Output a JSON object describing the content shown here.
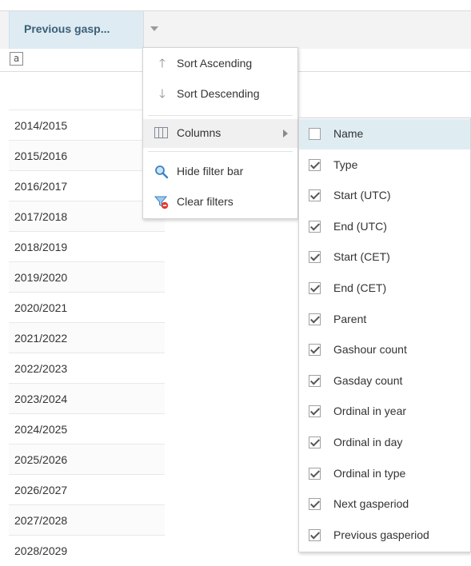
{
  "grid": {
    "column_title": "Previous gasp...",
    "filter_icon_text": "a",
    "rows": [
      "2014/2015",
      "2015/2016",
      "2016/2017",
      "2017/2018",
      "2018/2019",
      "2019/2020",
      "2020/2021",
      "2021/2022",
      "2022/2023",
      "2023/2024",
      "2024/2025",
      "2025/2026",
      "2026/2027",
      "2027/2028",
      "2028/2029"
    ]
  },
  "menu": {
    "sort_ascending": "Sort Ascending",
    "sort_descending": "Sort Descending",
    "columns": "Columns",
    "hide_filter_bar": "Hide filter bar",
    "clear_filters": "Clear filters"
  },
  "columns_submenu": [
    {
      "label": "Name",
      "checked": false
    },
    {
      "label": "Type",
      "checked": true
    },
    {
      "label": "Start (UTC)",
      "checked": true
    },
    {
      "label": "End (UTC)",
      "checked": true
    },
    {
      "label": "Start (CET)",
      "checked": true
    },
    {
      "label": "End (CET)",
      "checked": true
    },
    {
      "label": "Parent",
      "checked": true
    },
    {
      "label": "Gashour count",
      "checked": true
    },
    {
      "label": "Gasday count",
      "checked": true
    },
    {
      "label": "Ordinal in year",
      "checked": true
    },
    {
      "label": "Ordinal in day",
      "checked": true
    },
    {
      "label": "Ordinal in type",
      "checked": true
    },
    {
      "label": "Next gasperiod",
      "checked": true
    },
    {
      "label": "Previous gasperiod",
      "checked": true
    }
  ],
  "colors": {
    "header_active": "#deebf2",
    "header_text": "#3a5f78",
    "highlight": "#dfedf3"
  },
  "icons": {
    "sort_ascending": "arrow-up-icon",
    "sort_descending": "arrow-down-icon",
    "columns": "columns-icon",
    "hide_filter_bar": "magnifier-icon",
    "clear_filters": "funnel-clear-icon"
  }
}
